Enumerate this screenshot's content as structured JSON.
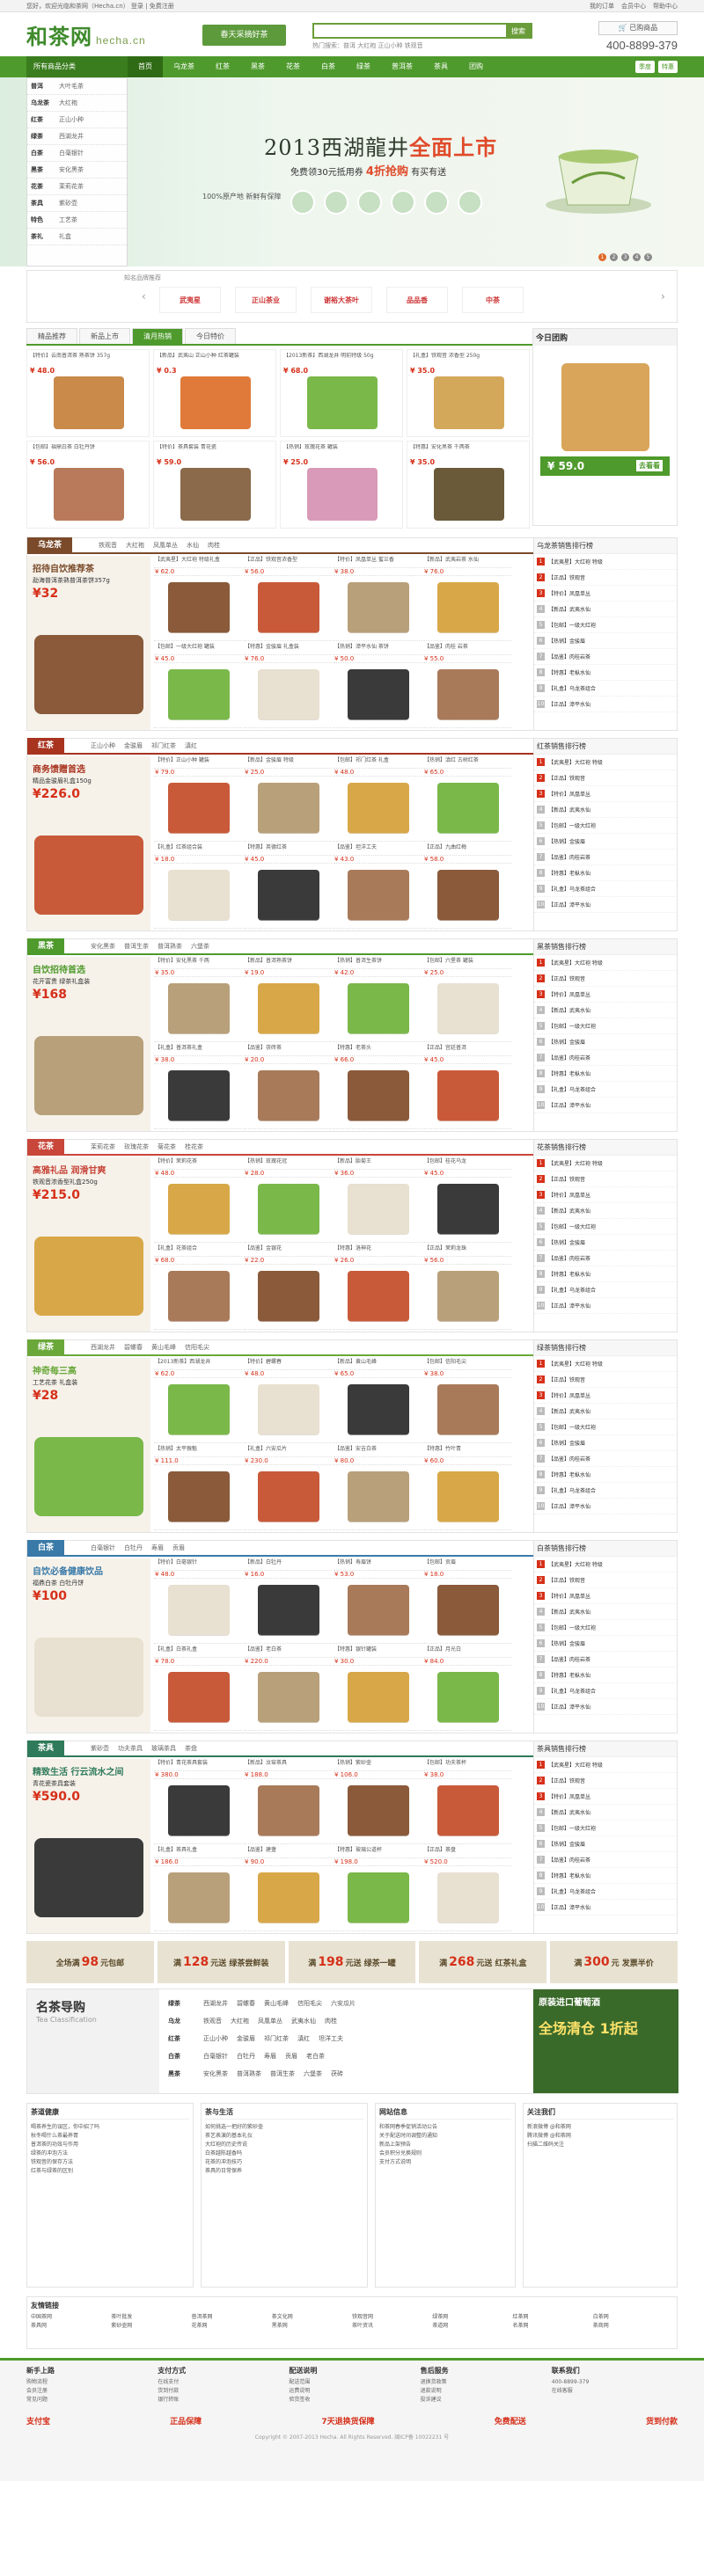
{
  "topbar": {
    "left": "您好，欢迎光临和茶网（Hecha.cn） 登录 | 免费注册",
    "links": [
      "我的订单",
      "会员中心",
      "帮助中心"
    ]
  },
  "header": {
    "logo": "和茶网",
    "logo_sub": "hecha.cn",
    "banner": "春天采摘好茶",
    "search_placeholder": "",
    "search_button": "搜索",
    "hot": "热门搜索：普洱 大红袍 正山小种 铁观音",
    "cart": "已购商品",
    "phone": "400-8899-379"
  },
  "nav": {
    "all": "所有商品分类",
    "items": [
      "首页",
      "乌龙茶",
      "红茶",
      "黑茶",
      "花茶",
      "白茶",
      "绿茶",
      "普洱茶",
      "茶具",
      "团购"
    ],
    "right": [
      "季度",
      "特惠"
    ]
  },
  "sidemenu": [
    {
      "b": "普洱",
      "s": "大叶毛茶"
    },
    {
      "b": "乌龙茶",
      "s": "大红袍"
    },
    {
      "b": "红茶",
      "s": "正山小种"
    },
    {
      "b": "绿茶",
      "s": "西湖龙井"
    },
    {
      "b": "白茶",
      "s": "白毫银针"
    },
    {
      "b": "黑茶",
      "s": "安化黑茶"
    },
    {
      "b": "花茶",
      "s": "茉莉花茶"
    },
    {
      "b": "茶具",
      "s": "紫砂壶"
    },
    {
      "b": "特色",
      "s": "工艺茶"
    },
    {
      "b": "茶礼",
      "s": "礼盒"
    }
  ],
  "hero": {
    "title": "2013西湖龍井",
    "title_hi": "全面上市",
    "sub": "免费领30元抵用券",
    "sub_hi": "4折抢购",
    "sub2": "有买有送",
    "note": "100%原产地 新鲜有保障",
    "dots": [
      "1",
      "2",
      "3",
      "4",
      "5"
    ]
  },
  "brands": {
    "title": "知名品牌推荐",
    "items": [
      "武夷星",
      "正山茶业",
      "谢裕大茶叶",
      "品品香",
      "中茶"
    ]
  },
  "rec": {
    "tabs": [
      "精品推荐",
      "新品上市",
      "清月热销",
      "今日特价"
    ],
    "active": 2,
    "products": [
      {
        "nm": "【特价】云南普洱茶 熟茶饼 357g",
        "pr": "¥ 48.0"
      },
      {
        "nm": "【新品】武夷山 正山小种 红茶罐装",
        "pr": "¥ 0.3"
      },
      {
        "nm": "【2013新茶】西湖龙井 明前特级 50g",
        "pr": "¥ 68.0"
      },
      {
        "nm": "【礼盒】铁观音 浓香型 250g",
        "pr": "¥ 35.0"
      },
      {
        "nm": "【包邮】福鼎白茶 白牡丹饼",
        "pr": "¥ 56.0"
      },
      {
        "nm": "【特价】茶具套装 青花瓷",
        "pr": "¥ 59.0"
      },
      {
        "nm": "【热销】玫瑰花茶 罐装",
        "pr": "¥ 25.0"
      },
      {
        "nm": "【特惠】安化黑茶 千两茶",
        "pr": "¥ 35.0"
      }
    ]
  },
  "today": {
    "title": "今日团购",
    "price": "¥ 59.0",
    "btn": "去看看"
  },
  "floors": [
    {
      "name": "乌龙茶",
      "color": "#7a4a2a",
      "tabs": [
        "铁观音",
        "大红袍",
        "凤凰单丛",
        "水仙",
        "肉桂"
      ],
      "t1": "招待自饮推荐茶",
      "t2": "勐海普洱茶熟普洱茶饼357g",
      "t3": "¥32",
      "rank": "乌龙茶销售排行榜",
      "items": [
        {
          "nm": "【武夷星】大红袍 特级礼盒",
          "pr": "¥ 62.0"
        },
        {
          "nm": "【正品】铁观音浓香型",
          "pr": "¥ 56.0"
        },
        {
          "nm": "【特价】凤凰单丛 蜜兰香",
          "pr": "¥ 38.0"
        },
        {
          "nm": "【新品】武夷岩茶 水仙",
          "pr": "¥ 76.0"
        },
        {
          "nm": "【包邮】一级大红袍 罐装",
          "pr": "¥ 45.0"
        },
        {
          "nm": "【特惠】金骏眉 礼盒装",
          "pr": "¥ 76.0"
        },
        {
          "nm": "【热销】漳平水仙 茶饼",
          "pr": "¥ 50.0"
        },
        {
          "nm": "【品鉴】肉桂 岩茶",
          "pr": "¥ 55.0"
        }
      ]
    },
    {
      "name": "红茶",
      "color": "#a8331f",
      "tabs": [
        "正山小种",
        "金骏眉",
        "祁门红茶",
        "滇红"
      ],
      "t1": "商务馈赠首选",
      "t2": "精品金骏眉礼盒150g",
      "t3": "¥226.0",
      "rank": "红茶销售排行榜",
      "items": [
        {
          "nm": "【特价】正山小种 罐装",
          "pr": "¥ 79.0"
        },
        {
          "nm": "【新品】金骏眉 特级",
          "pr": "¥ 25.0"
        },
        {
          "nm": "【包邮】祁门红茶 礼盒",
          "pr": "¥ 48.0"
        },
        {
          "nm": "【热销】滇红 古树红茶",
          "pr": "¥ 65.0"
        },
        {
          "nm": "【礼盒】红茶组合装",
          "pr": "¥ 18.0"
        },
        {
          "nm": "【特惠】英德红茶",
          "pr": "¥ 45.0"
        },
        {
          "nm": "【品鉴】坦洋工夫",
          "pr": "¥ 43.0"
        },
        {
          "nm": "【正品】九曲红梅",
          "pr": "¥ 58.0"
        }
      ]
    },
    {
      "name": "黑茶",
      "color": "#4e9a2c",
      "tabs": [
        "安化黑茶",
        "普洱生茶",
        "普洱熟茶",
        "六堡茶"
      ],
      "t1": "自饮招待首选",
      "t2": "花开富贵 绿茶礼盒装",
      "t3": "¥168",
      "rank": "黑茶销售排行榜",
      "items": [
        {
          "nm": "【特价】安化黑茶 千两",
          "pr": "¥ 35.0"
        },
        {
          "nm": "【新品】普洱熟茶饼",
          "pr": "¥ 19.0"
        },
        {
          "nm": "【热销】普洱生茶饼",
          "pr": "¥ 42.0"
        },
        {
          "nm": "【包邮】六堡茶 罐装",
          "pr": "¥ 25.0"
        },
        {
          "nm": "【礼盒】普洱茶礼盒",
          "pr": "¥ 38.0"
        },
        {
          "nm": "【品鉴】茯砖茶",
          "pr": "¥ 20.0"
        },
        {
          "nm": "【特惠】老茶头",
          "pr": "¥ 66.0"
        },
        {
          "nm": "【正品】宫廷普洱",
          "pr": "¥ 45.0"
        }
      ]
    },
    {
      "name": "花茶",
      "color": "#c8463a",
      "tabs": [
        "茉莉花茶",
        "玫瑰花茶",
        "菊花茶",
        "桂花茶"
      ],
      "t1": "高雅礼品 润滑甘爽",
      "t2": "铁观音浓香型礼盒250g",
      "t3": "¥215.0",
      "rank": "花茶销售排行榜",
      "items": [
        {
          "nm": "【特价】茉莉花茶",
          "pr": "¥ 48.0"
        },
        {
          "nm": "【热销】玫瑰花冠",
          "pr": "¥ 28.0"
        },
        {
          "nm": "【新品】胎菊王",
          "pr": "¥ 36.0"
        },
        {
          "nm": "【包邮】桂花乌龙",
          "pr": "¥ 45.0"
        },
        {
          "nm": "【礼盒】花茶组合",
          "pr": "¥ 68.0"
        },
        {
          "nm": "【品鉴】金银花",
          "pr": "¥ 22.0"
        },
        {
          "nm": "【特惠】洛神花",
          "pr": "¥ 26.0"
        },
        {
          "nm": "【正品】茉莉龙珠",
          "pr": "¥ 56.0"
        }
      ]
    },
    {
      "name": "绿茶",
      "color": "#6aa83a",
      "tabs": [
        "西湖龙井",
        "碧螺春",
        "黄山毛峰",
        "信阳毛尖"
      ],
      "t1": "神奇每三高",
      "t2": "工艺花茶 礼盒装",
      "t3": "¥28",
      "rank": "绿茶销售排行榜",
      "items": [
        {
          "nm": "【2013新茶】西湖龙井",
          "pr": "¥ 62.0"
        },
        {
          "nm": "【特价】碧螺春",
          "pr": "¥ 48.0"
        },
        {
          "nm": "【新品】黄山毛峰",
          "pr": "¥ 65.0"
        },
        {
          "nm": "【包邮】信阳毛尖",
          "pr": "¥ 38.0"
        },
        {
          "nm": "【热销】太平猴魁",
          "pr": "¥ 111.0"
        },
        {
          "nm": "【礼盒】六安瓜片",
          "pr": "¥ 230.0"
        },
        {
          "nm": "【品鉴】安吉白茶",
          "pr": "¥ 80.0"
        },
        {
          "nm": "【特惠】竹叶青",
          "pr": "¥ 60.0"
        }
      ]
    },
    {
      "name": "白茶",
      "color": "#3a7aa8",
      "tabs": [
        "白毫银针",
        "白牡丹",
        "寿眉",
        "贡眉"
      ],
      "t1": "自饮必备健康饮品",
      "t2": "福鼎白茶 白牡丹饼",
      "t3": "¥100",
      "rank": "白茶销售排行榜",
      "items": [
        {
          "nm": "【特价】白毫银针",
          "pr": "¥ 48.0"
        },
        {
          "nm": "【新品】白牡丹",
          "pr": "¥ 16.0"
        },
        {
          "nm": "【热销】寿眉饼",
          "pr": "¥ 53.0"
        },
        {
          "nm": "【包邮】贡眉",
          "pr": "¥ 18.0"
        },
        {
          "nm": "【礼盒】白茶礼盒",
          "pr": "¥ 78.0"
        },
        {
          "nm": "【品鉴】老白茶",
          "pr": "¥ 220.0"
        },
        {
          "nm": "【特惠】银针罐装",
          "pr": "¥ 30.0"
        },
        {
          "nm": "【正品】月光白",
          "pr": "¥ 84.0"
        }
      ]
    },
    {
      "name": "茶具",
      "color": "#2f7a5a",
      "tabs": [
        "紫砂壶",
        "功夫茶具",
        "玻璃茶具",
        "茶盘"
      ],
      "t1": "精致生活 行云流水之间",
      "t2": "青花瓷茶具套装",
      "t3": "¥590.0",
      "rank": "茶具销售排行榜",
      "items": [
        {
          "nm": "【特价】青花茶具套装",
          "pr": "¥ 380.0"
        },
        {
          "nm": "【新品】汝窑茶具",
          "pr": "¥ 188.0"
        },
        {
          "nm": "【热销】紫砂壶",
          "pr": "¥ 106.0"
        },
        {
          "nm": "【包邮】功夫茶杯",
          "pr": "¥ 38.0"
        },
        {
          "nm": "【礼盒】茶具礼盒",
          "pr": "¥ 186.0"
        },
        {
          "nm": "【品鉴】建盏",
          "pr": "¥ 90.0"
        },
        {
          "nm": "【特惠】玻璃公道杯",
          "pr": "¥ 198.0"
        },
        {
          "nm": "【正品】茶盘",
          "pr": "¥ 520.0"
        }
      ]
    }
  ],
  "rank_items": [
    "【武夷星】大红袍 特级",
    "【正品】铁观音",
    "【特价】凤凰单丛",
    "【新品】武夷水仙",
    "【包邮】一级大红袍",
    "【热销】金骏眉",
    "【品鉴】肉桂岩茶",
    "【特惠】老枞水仙",
    "【礼盒】乌龙茶组合",
    "【正品】漳平水仙"
  ],
  "promos": [
    {
      "a": "全场满",
      "n": "98",
      "b": "元包邮"
    },
    {
      "a": "满",
      "n": "128",
      "b": "元送 绿茶尝鲜装"
    },
    {
      "a": "满",
      "n": "198",
      "b": "元送 绿茶一罐"
    },
    {
      "a": "满",
      "n": "268",
      "b": "元送 红茶礼盒"
    },
    {
      "a": "满",
      "n": "300",
      "b": "元 发票半价"
    }
  ],
  "guide": {
    "t1": "名茶导购",
    "t2": "Tea Classification",
    "rows": [
      {
        "b": "绿茶",
        "s": [
          "西湖龙井",
          "碧螺春",
          "黄山毛峰",
          "信阳毛尖",
          "六安瓜片"
        ]
      },
      {
        "b": "乌龙",
        "s": [
          "铁观音",
          "大红袍",
          "凤凰单丛",
          "武夷水仙",
          "肉桂"
        ]
      },
      {
        "b": "红茶",
        "s": [
          "正山小种",
          "金骏眉",
          "祁门红茶",
          "滇红",
          "坦洋工夫"
        ]
      },
      {
        "b": "白茶",
        "s": [
          "白毫银针",
          "白牡丹",
          "寿眉",
          "贡眉",
          "老白茶"
        ]
      },
      {
        "b": "黑茶",
        "s": [
          "安化黑茶",
          "普洱熟茶",
          "普洱生茶",
          "六堡茶",
          "茯砖"
        ]
      }
    ],
    "clear_title": "原装进口葡萄酒",
    "clear_big": "全场清仓 1折起"
  },
  "news": [
    {
      "hd": "茶道健康",
      "li": [
        "喝茶养生的误区，你中招了吗",
        "秋冬喝什么茶最养胃",
        "普洱茶的功效与作用",
        "绿茶的冲泡方法",
        "铁观音的保存方法",
        "红茶与绿茶的区别"
      ]
    },
    {
      "hd": "茶与生活",
      "li": [
        "如何挑选一把好的紫砂壶",
        "茶艺表演的基本礼仪",
        "大红袍的历史传说",
        "白茶越陈越香吗",
        "花茶的冲泡技巧",
        "茶具的日常保养"
      ]
    },
    {
      "hd": "网站信息",
      "li": [
        "和茶网春季促销活动公告",
        "关于配送时间调整的通知",
        "新品上架预告",
        "会员积分兑换规则",
        "支付方式说明"
      ]
    },
    {
      "hd": "关注我们",
      "li": [
        "新浪微博 @和茶网",
        "腾讯微博 @和茶网",
        "扫描二维码关注"
      ]
    }
  ],
  "links": {
    "hd": "友情链接",
    "items": [
      "中国茶网",
      "茶叶批发",
      "普洱茶网",
      "茶文化网",
      "铁观音网",
      "绿茶网",
      "红茶网",
      "白茶网",
      "茶具网",
      "紫砂壶网",
      "花茶网",
      "黑茶网",
      "茶叶资讯",
      "茶道网",
      "名茶网",
      "茶商网"
    ]
  },
  "footer": {
    "cols": [
      {
        "t": "新手上路",
        "l": [
          "购物流程",
          "会员注册",
          "常见问题"
        ]
      },
      {
        "t": "支付方式",
        "l": [
          "在线支付",
          "货到付款",
          "银行转账"
        ]
      },
      {
        "t": "配送说明",
        "l": [
          "配送范围",
          "运费说明",
          "验货签收"
        ]
      },
      {
        "t": "售后服务",
        "l": [
          "退换货政策",
          "退款说明",
          "投诉建议"
        ]
      },
      {
        "t": "联系我们",
        "l": [
          "400-8899-379",
          "在线客服"
        ]
      }
    ],
    "svc": [
      "支付宝",
      "正品保障",
      "7天退换货保障",
      "免费配送",
      "货到付款"
    ],
    "copyright": "Copyright © 2007-2013 Hecha. All Rights Reserved. 闽ICP备 10022231 号"
  }
}
